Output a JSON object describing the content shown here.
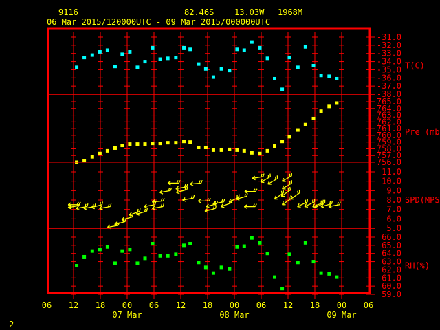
{
  "header": {
    "station": "9116",
    "latitude": "82.46S",
    "longitude": "13.03W",
    "elevation": "1968M",
    "time_range": "06 Mar 2015/120000UTC - 09 Mar 2015/000000UTC"
  },
  "footer": {
    "frame_number": "2"
  },
  "x_axis": {
    "tick_labels": [
      "06",
      "12",
      "18",
      "00",
      "06",
      "12",
      "18",
      "00",
      "06",
      "12",
      "18",
      "00",
      "06"
    ],
    "date_labels": [
      {
        "label": "07 Mar",
        "at": "2015-03-07T00:00"
      },
      {
        "label": "08 Mar",
        "at": "2015-03-08T00:00"
      },
      {
        "label": "09 Mar",
        "at": "2015-03-09T00:00"
      }
    ]
  },
  "colors": {
    "frame": "#ff0000",
    "text": "#ffff00",
    "temperature": "#00ffff",
    "pressure": "#ffff00",
    "wind": "#ffff00",
    "rh": "#00ff00"
  },
  "chart_data": {
    "type": "scatter",
    "xlim": [
      "2015-03-06T06:00",
      "2015-03-09T06:00"
    ],
    "x": [
      "2015-03-06T12:42",
      "2015-03-06T14:24",
      "2015-03-06T16:12",
      "2015-03-06T17:54",
      "2015-03-06T19:36",
      "2015-03-06T21:18",
      "2015-03-06T22:54",
      "2015-03-07T00:36",
      "2015-03-07T02:18",
      "2015-03-07T04:00",
      "2015-03-07T05:42",
      "2015-03-07T07:24",
      "2015-03-07T09:06",
      "2015-03-07T10:54",
      "2015-03-07T12:42",
      "2015-03-07T14:06",
      "2015-03-07T16:00",
      "2015-03-07T17:36",
      "2015-03-07T19:18",
      "2015-03-07T21:06",
      "2015-03-07T22:54",
      "2015-03-08T00:36",
      "2015-03-08T02:12",
      "2015-03-08T03:54",
      "2015-03-08T05:42",
      "2015-03-08T07:24",
      "2015-03-08T09:00",
      "2015-03-08T10:42",
      "2015-03-08T12:18",
      "2015-03-08T14:12",
      "2015-03-08T15:54",
      "2015-03-08T17:42",
      "2015-03-08T19:24",
      "2015-03-08T21:12",
      "2015-03-08T22:54"
    ],
    "panels": [
      {
        "id": "temperature",
        "ylabel": "T(C)",
        "ylim": [
          -38,
          -31
        ],
        "yticks": [
          "-31.0",
          "-32.0",
          "-33.0",
          "-34.0",
          "-35.0",
          "-36.0",
          "-37.0",
          "-38.0"
        ],
        "color": "#00ffff",
        "values": [
          -34.7,
          -33.5,
          -33.2,
          -32.8,
          -32.6,
          -34.6,
          -33.1,
          -32.8,
          -34.7,
          -34.0,
          -32.3,
          -33.7,
          -33.6,
          -33.5,
          -32.3,
          -32.5,
          -34.3,
          -34.9,
          -35.9,
          -34.9,
          -35.1,
          -32.5,
          -32.6,
          -31.6,
          -32.3,
          -33.6,
          -36.1,
          -37.4,
          -33.5,
          -34.7,
          -32.2,
          -34.5,
          -35.7,
          -35.8,
          -36.1
        ]
      },
      {
        "id": "pressure",
        "ylabel": "Pre (mb)",
        "ylim": [
          756,
          765
        ],
        "yticks": [
          "765.0",
          "764.0",
          "763.0",
          "762.0",
          "761.0",
          "760.0",
          "759.0",
          "758.0",
          "757.0",
          "756.0"
        ],
        "color": "#ffff00",
        "values": [
          756.0,
          756.2,
          756.8,
          757.3,
          757.7,
          758.1,
          758.5,
          758.7,
          758.7,
          758.7,
          758.8,
          758.8,
          758.9,
          758.9,
          759.1,
          759.0,
          758.2,
          758.2,
          757.8,
          757.8,
          757.9,
          757.8,
          757.7,
          757.4,
          757.3,
          757.7,
          758.4,
          759.1,
          759.8,
          760.8,
          761.6,
          762.5,
          763.6,
          764.3,
          764.8
        ]
      },
      {
        "id": "wind",
        "ylabel": "SPD(MPS)",
        "ylim": [
          5,
          11
        ],
        "yticks": [
          "11.0",
          "10.0",
          "9.0",
          "8.0",
          "7.0",
          "6.0",
          "5.0"
        ],
        "color": "#ffff00",
        "barbs": [
          {
            "time": "2015-03-06T10:48",
            "speed": 7.5,
            "dir": 90
          },
          {
            "time": "2015-03-06T10:48",
            "speed": 7.2,
            "dir": 80
          },
          {
            "time": "2015-03-06T12:36",
            "speed": 7.1,
            "dir": 80
          },
          {
            "time": "2015-03-06T14:18",
            "speed": 7.1,
            "dir": 80
          },
          {
            "time": "2015-03-06T16:00",
            "speed": 7.2,
            "dir": 75
          },
          {
            "time": "2015-03-06T17:48",
            "speed": 7.1,
            "dir": 80
          },
          {
            "time": "2015-03-06T19:36",
            "speed": 5.1,
            "dir": 80
          },
          {
            "time": "2015-03-06T21:12",
            "speed": 5.4,
            "dir": 75
          },
          {
            "time": "2015-03-06T22:48",
            "speed": 5.9,
            "dir": 75
          },
          {
            "time": "2015-03-07T00:30",
            "speed": 6.4,
            "dir": 70
          },
          {
            "time": "2015-03-07T02:00",
            "speed": 6.5,
            "dir": 75
          },
          {
            "time": "2015-03-07T03:48",
            "speed": 7.3,
            "dir": 80
          },
          {
            "time": "2015-03-07T05:36",
            "speed": 7.1,
            "dir": 80
          },
          {
            "time": "2015-03-07T05:36",
            "speed": 7.8,
            "dir": 85
          },
          {
            "time": "2015-03-07T07:18",
            "speed": 8.8,
            "dir": 80
          },
          {
            "time": "2015-03-07T09:06",
            "speed": 9.8,
            "dir": 90
          },
          {
            "time": "2015-03-07T10:54",
            "speed": 9.2,
            "dir": 80
          },
          {
            "time": "2015-03-07T11:00",
            "speed": 8.8,
            "dir": 75
          },
          {
            "time": "2015-03-07T12:24",
            "speed": 8.0,
            "dir": 80
          },
          {
            "time": "2015-03-07T14:06",
            "speed": 9.7,
            "dir": 85
          },
          {
            "time": "2015-03-07T15:54",
            "speed": 7.9,
            "dir": 90
          },
          {
            "time": "2015-03-07T17:42",
            "speed": 7.3,
            "dir": 75
          },
          {
            "time": "2015-03-07T17:24",
            "speed": 6.8,
            "dir": 75
          },
          {
            "time": "2015-03-07T19:12",
            "speed": 7.6,
            "dir": 80
          },
          {
            "time": "2015-03-07T21:00",
            "speed": 7.3,
            "dir": 70
          },
          {
            "time": "2015-03-07T22:48",
            "speed": 7.8,
            "dir": 65
          },
          {
            "time": "2015-03-08T00:24",
            "speed": 8.1,
            "dir": 75
          },
          {
            "time": "2015-03-08T02:12",
            "speed": 7.3,
            "dir": 90
          },
          {
            "time": "2015-03-08T02:18",
            "speed": 8.9,
            "dir": 90
          },
          {
            "time": "2015-03-08T04:00",
            "speed": 10.3,
            "dir": 80
          },
          {
            "time": "2015-03-08T05:54",
            "speed": 9.9,
            "dir": 60
          },
          {
            "time": "2015-03-08T07:30",
            "speed": 9.7,
            "dir": 60
          },
          {
            "time": "2015-03-08T09:00",
            "speed": 8.1,
            "dir": 55
          },
          {
            "time": "2015-03-08T10:30",
            "speed": 8.4,
            "dir": 55
          },
          {
            "time": "2015-03-08T10:42",
            "speed": 9.2,
            "dir": 60
          },
          {
            "time": "2015-03-08T10:42",
            "speed": 10.0,
            "dir": 60
          },
          {
            "time": "2015-03-08T10:42",
            "speed": 7.5,
            "dir": 55
          },
          {
            "time": "2015-03-08T12:36",
            "speed": 8.1,
            "dir": 55
          },
          {
            "time": "2015-03-08T14:06",
            "speed": 7.3,
            "dir": 65
          },
          {
            "time": "2015-03-08T15:42",
            "speed": 7.3,
            "dir": 65
          },
          {
            "time": "2015-03-08T17:30",
            "speed": 7.3,
            "dir": 70
          },
          {
            "time": "2015-03-08T18:00",
            "speed": 7.2,
            "dir": 65
          },
          {
            "time": "2015-03-08T19:24",
            "speed": 7.3,
            "dir": 75
          },
          {
            "time": "2015-03-08T21:06",
            "speed": 7.3,
            "dir": 80
          }
        ]
      },
      {
        "id": "rh",
        "ylabel": "RH(%)",
        "ylim": [
          59,
          66
        ],
        "yticks": [
          "66.0",
          "65.0",
          "64.0",
          "63.0",
          "62.0",
          "61.0",
          "60.0",
          "59.0"
        ],
        "color": "#00ff00",
        "values": [
          62.5,
          63.6,
          64.3,
          64.5,
          64.8,
          62.8,
          64.3,
          64.5,
          62.8,
          63.4,
          65.2,
          63.7,
          63.7,
          63.9,
          65.0,
          65.2,
          62.9,
          62.3,
          61.6,
          62.3,
          62.1,
          64.8,
          64.9,
          65.9,
          65.3,
          64.0,
          61.1,
          59.7,
          63.9,
          62.9,
          65.3,
          63.0,
          61.6,
          61.5,
          61.1
        ]
      }
    ]
  }
}
